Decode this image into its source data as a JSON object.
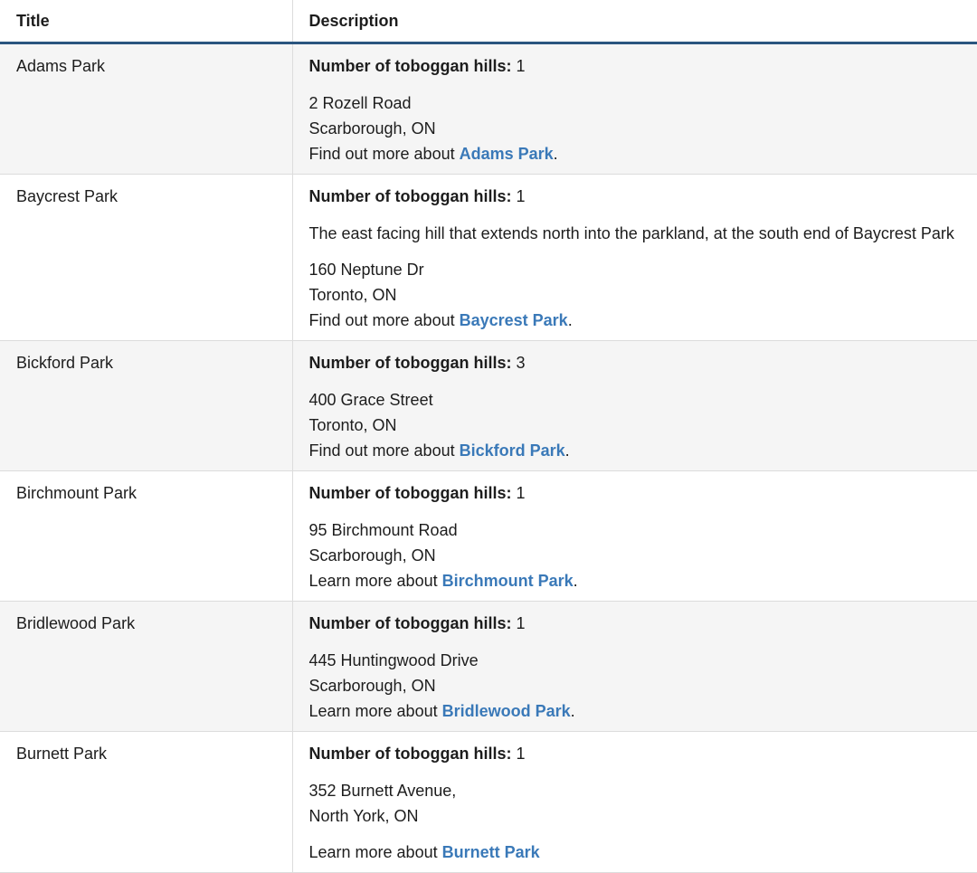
{
  "table": {
    "headers": {
      "title": "Title",
      "description": "Description"
    },
    "count_label": "Number of toboggan hills:",
    "rows": [
      {
        "title": "Adams Park",
        "count": "1",
        "note": "",
        "address_line1": "2 Rozell Road",
        "address_line2": "Scarborough, ON",
        "more_prefix": "Find out more about ",
        "link_text": "Adams Park",
        "more_suffix": "."
      },
      {
        "title": "Baycrest Park",
        "count": "1",
        "note": "The east facing hill that extends north into the parkland, at the south end of Baycrest Park",
        "address_line1": "160 Neptune Dr",
        "address_line2": "Toronto, ON",
        "more_prefix": "Find out more about ",
        "link_text": "Baycrest Park",
        "more_suffix": "."
      },
      {
        "title": "Bickford Park",
        "count": "3",
        "note": "",
        "address_line1": "400 Grace Street",
        "address_line2": "Toronto, ON",
        "more_prefix": "Find out more about ",
        "link_text": "Bickford Park",
        "more_suffix": "."
      },
      {
        "title": "Birchmount Park",
        "count": "1",
        "note": "",
        "address_line1": "95 Birchmount Road",
        "address_line2": "Scarborough, ON",
        "more_prefix": "Learn more about ",
        "link_text": "Birchmount Park",
        "more_suffix": "."
      },
      {
        "title": "Bridlewood Park",
        "count": "1",
        "note": "",
        "address_line1": "445 Huntingwood Drive",
        "address_line2": "Scarborough, ON",
        "more_prefix": "Learn more about ",
        "link_text": "Bridlewood Park",
        "more_suffix": "."
      },
      {
        "title": "Burnett Park",
        "count": "1",
        "note": "",
        "address_line1": "352 Burnett Avenue,",
        "address_line2": "North York, ON",
        "more_prefix": "Learn more about ",
        "link_text": "Burnett Park",
        "more_suffix": ""
      }
    ]
  },
  "colors": {
    "header_rule": "#2a557f",
    "link": "#3a79b8",
    "row_shade": "#f5f5f5",
    "border": "#dcdcdc"
  }
}
